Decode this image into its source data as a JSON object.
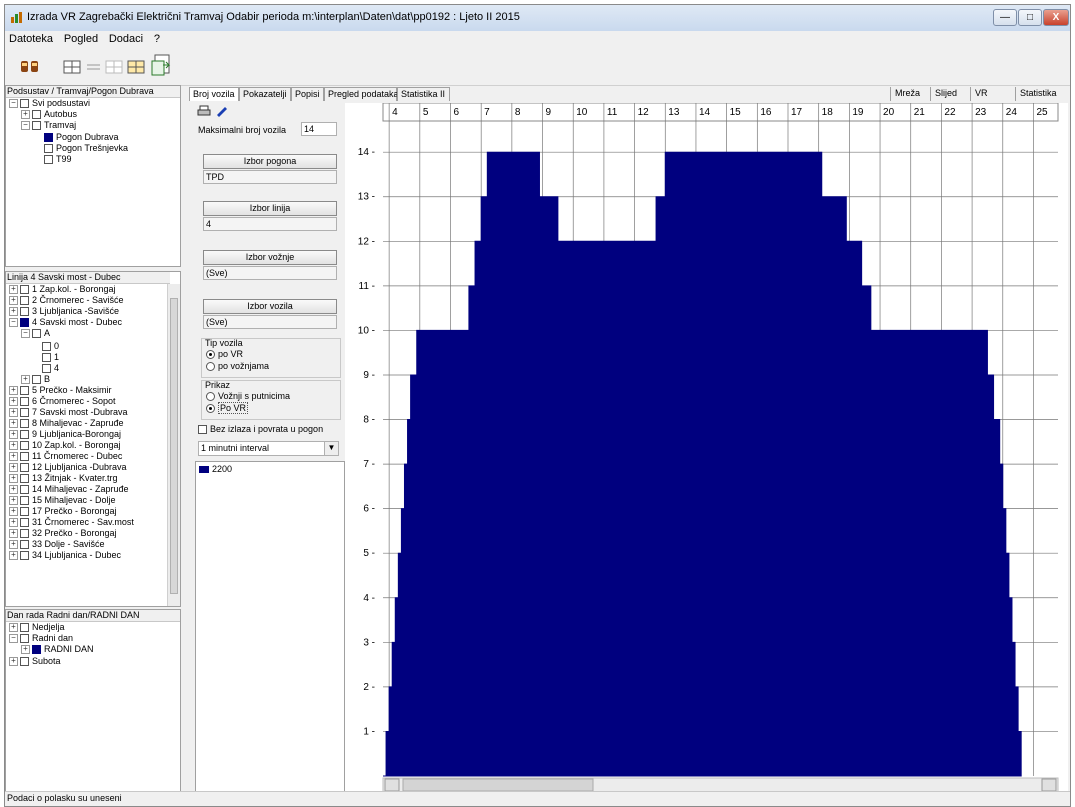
{
  "window": {
    "title": "Izrada VR  Zagrebački Električni Tramvaj Odabir perioda m:\\interplan\\Daten\\dat\\pp0192 : Ljeto II 2015",
    "minimize": "—",
    "maximize": "□",
    "close": "X"
  },
  "menu": [
    "Datoteka",
    "Pogled",
    "Dodaci",
    "?"
  ],
  "subsystem": {
    "header": "Podsustav / Tramvaj/Pogon Dubrava",
    "items": [
      "Svi podsustavi",
      "Autobus",
      "Tramvaj",
      "Pogon Dubrava",
      "Pogon Trešnjevka",
      "T99"
    ]
  },
  "lines": {
    "header": "Linija 4 Savski most - Dubec",
    "items": [
      "1 Zap.kol. - Borongaj",
      "2 Črnomerec - Savišće",
      "3 Ljubljanica -Savišće",
      "4 Savski most - Dubec",
      "A",
      "0",
      "1",
      "4",
      "B",
      "5 Prečko - Maksimir",
      "6 Črnomerec - Sopot",
      "7 Savski most -Dubrava",
      "8 Mihaljevac - Zapruđe",
      "9 Ljubljanica-Borongaj",
      "10 Zap.kol. - Borongaj",
      "11 Črnomerec - Dubec",
      "12 Ljubljanica -Dubrava",
      "13 Žitnjak - Kvater.trg",
      "14 Mihaljevac - Zapruđe",
      "15 Mihaljevac - Dolje",
      "17 Prečko - Borongaj",
      "31 Črnomerec - Sav.most",
      "32 Prečko - Borongaj",
      "33 Dolje - Savišće",
      "34 Ljubljanica - Dubec"
    ]
  },
  "daytype": {
    "header": "Dan rada  Radni dan/RADNI DAN",
    "items": [
      "Nedjelja",
      "Radni dan",
      "RADNI DAN",
      "Subota"
    ]
  },
  "tabs": [
    "Broj vozila",
    "Pokazatelji",
    "Popisi",
    "Pregled podataka",
    "Statistika II"
  ],
  "right_tabs": [
    "Mreža",
    "Slijed",
    "VR",
    "Statistika"
  ],
  "controls": {
    "max_label": "Maksimalni broj vozila",
    "max_value": "14",
    "pogon_button": "Izbor pogona",
    "pogon_value": "TPD",
    "linija_button": "Izbor linija",
    "linija_value": "4",
    "voznja_button": "Izbor vožnje",
    "voznja_value": "(Sve)",
    "vozila_button": "Izbor vozila",
    "vozila_value": "(Sve)",
    "tip_label": "Tip vozila",
    "tip_opt1": "po VR",
    "tip_opt2": "po vožnjama",
    "prikaz_label": "Prikaz",
    "prikaz_opt1": "Vožnji s putnicima",
    "prikaz_opt2": "Po VR",
    "bez_label": "Bez izlaza i povrata u pogon",
    "interval_value": "1 minutni interval",
    "legend_entry": "2200"
  },
  "status": "Podaci o polasku su uneseni",
  "chart_data": {
    "type": "area",
    "title": "",
    "xlabel": "",
    "ylabel": "",
    "xlim": [
      3.8,
      25.8
    ],
    "ylim": [
      0,
      14.7
    ],
    "grid": true,
    "xticks": [
      4,
      5,
      6,
      7,
      8,
      9,
      10,
      11,
      12,
      13,
      14,
      15,
      16,
      17,
      18,
      19,
      20,
      21,
      22,
      23,
      24,
      25
    ],
    "yticks": [
      1,
      2,
      3,
      4,
      5,
      6,
      7,
      8,
      9,
      10,
      11,
      12,
      13,
      14
    ],
    "fill_color": "#00007f",
    "series": [
      {
        "name": "2200",
        "step_points": [
          [
            3.8,
            0
          ],
          [
            3.9,
            1
          ],
          [
            4.0,
            2
          ],
          [
            4.1,
            3
          ],
          [
            4.2,
            4
          ],
          [
            4.3,
            5
          ],
          [
            4.4,
            6
          ],
          [
            4.5,
            7
          ],
          [
            4.6,
            8
          ],
          [
            4.7,
            9
          ],
          [
            4.9,
            10
          ],
          [
            6.6,
            11
          ],
          [
            6.8,
            12
          ],
          [
            7.0,
            13
          ],
          [
            7.2,
            14
          ],
          [
            8.9,
            13
          ],
          [
            9.5,
            12
          ],
          [
            11.0,
            12
          ],
          [
            12.7,
            13
          ],
          [
            13.0,
            14
          ],
          [
            18.1,
            13
          ],
          [
            18.9,
            12
          ],
          [
            19.4,
            11
          ],
          [
            19.7,
            10
          ],
          [
            20.7,
            10
          ],
          [
            21.0,
            10
          ],
          [
            21.2,
            10
          ],
          [
            23.3,
            10
          ],
          [
            23.5,
            9
          ],
          [
            23.7,
            8
          ],
          [
            23.9,
            7
          ],
          [
            24.0,
            6
          ],
          [
            24.1,
            5
          ],
          [
            24.2,
            4
          ],
          [
            24.3,
            3
          ],
          [
            24.4,
            2
          ],
          [
            24.5,
            1
          ],
          [
            24.6,
            0
          ]
        ]
      }
    ]
  }
}
